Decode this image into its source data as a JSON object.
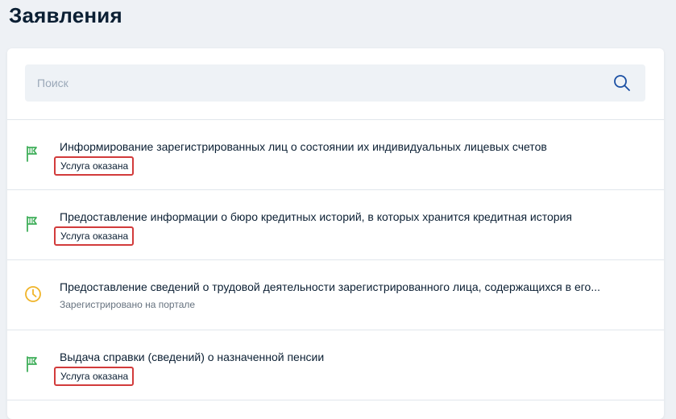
{
  "page": {
    "title": "Заявления"
  },
  "search": {
    "placeholder": "Поиск"
  },
  "applications": [
    {
      "title": "Информирование зарегистрированных лиц о состоянии их индивидуальных лицевых счетов",
      "status": "Услуга оказана",
      "icon": "flag-icon",
      "icon_color": "#3fae5a"
    },
    {
      "title": "Предоставление информации о бюро кредитных историй, в которых хранится кредитная история",
      "status": "Услуга оказана",
      "icon": "flag-icon",
      "icon_color": "#3fae5a"
    },
    {
      "title": "Предоставление сведений о трудовой деятельности зарегистрированного лица, содержащихся в его...",
      "status": "Зарегистрировано на портале",
      "icon": "clock-icon",
      "icon_color": "#f0b429"
    },
    {
      "title": "Выдача справки (сведений) о назначенной пенсии",
      "status": "Услуга оказана",
      "icon": "flag-icon",
      "icon_color": "#3fae5a"
    }
  ],
  "colors": {
    "highlight": "#d23b3b",
    "accent": "#0d4cd3"
  }
}
